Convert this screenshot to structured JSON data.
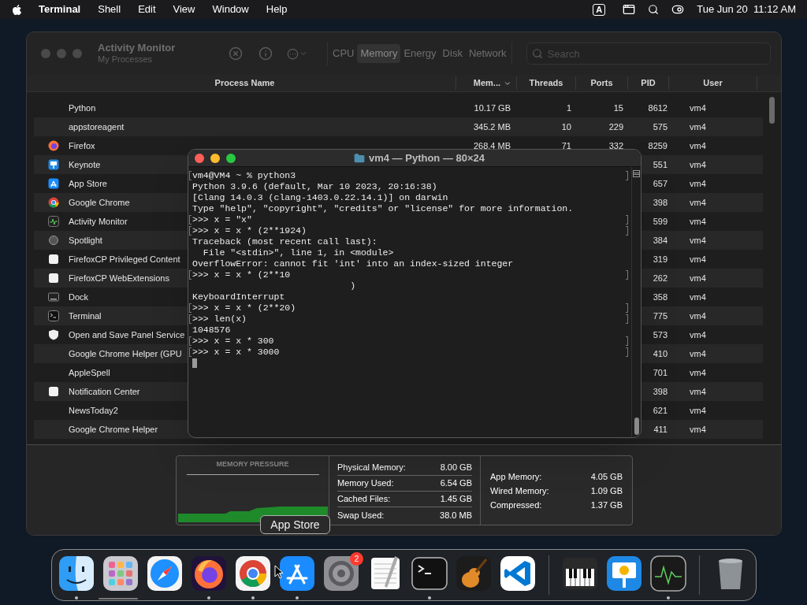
{
  "menu_bar": {
    "app": "Terminal",
    "menus": [
      "Shell",
      "Edit",
      "View",
      "Window",
      "Help"
    ],
    "input_source": "A",
    "clock": "Tue Jun 20  11:12 AM"
  },
  "activity_monitor": {
    "title": "Activity Monitor",
    "subtitle": "My Processes",
    "tabs": [
      {
        "label": "CPU",
        "selected": false
      },
      {
        "label": "Memory",
        "selected": true
      },
      {
        "label": "Energy",
        "selected": false
      },
      {
        "label": "Disk",
        "selected": false
      },
      {
        "label": "Network",
        "selected": false
      }
    ],
    "search": {
      "placeholder": "Search"
    },
    "columns": [
      "Process Name",
      "Mem...",
      "Threads",
      "Ports",
      "PID",
      "User"
    ],
    "rows": [
      {
        "kind": "plain",
        "name": "Python",
        "memory": "10.17 GB",
        "threads": "1",
        "ports": "15",
        "pid": "8612",
        "user": "vm4"
      },
      {
        "kind": "plain",
        "name": "appstoreagent",
        "memory": "345.2 MB",
        "threads": "10",
        "ports": "229",
        "pid": "575",
        "user": "vm4"
      },
      {
        "kind": "firefox",
        "name": "Firefox",
        "memory": "268.4 MB",
        "threads": "71",
        "ports": "332",
        "pid": "8259",
        "user": "vm4"
      },
      {
        "kind": "keynote",
        "name": "Keynote",
        "pid": "551",
        "user": "vm4"
      },
      {
        "kind": "appstore",
        "name": "App Store",
        "pid": "657",
        "user": "vm4"
      },
      {
        "kind": "chrome",
        "name": "Google Chrome",
        "pid": "398",
        "user": "vm4"
      },
      {
        "kind": "activity",
        "name": "Activity Monitor",
        "pid": "599",
        "user": "vm4"
      },
      {
        "kind": "spotlight",
        "name": "Spotlight",
        "pid": "384",
        "user": "vm4"
      },
      {
        "kind": "document",
        "name": "FirefoxCP Privileged Content",
        "pid": "319",
        "user": "vm4"
      },
      {
        "kind": "document",
        "name": "FirefoxCP WebExtensions",
        "pid": "262",
        "user": "vm4"
      },
      {
        "kind": "dock",
        "name": "Dock",
        "pid": "358",
        "user": "vm4"
      },
      {
        "kind": "terminal",
        "name": "Terminal",
        "pid": "775",
        "user": "vm4"
      },
      {
        "kind": "shield",
        "name": "Open and Save Panel Service",
        "pid": "573",
        "user": "vm4"
      },
      {
        "kind": "plain",
        "name": "Google Chrome Helper (GPU",
        "pid": "410",
        "user": "vm4"
      },
      {
        "kind": "plain",
        "name": "AppleSpell",
        "pid": "701",
        "user": "vm4"
      },
      {
        "kind": "document",
        "name": "Notification Center",
        "pid": "398",
        "user": "vm4"
      },
      {
        "kind": "plain",
        "name": "NewsToday2",
        "pid": "621",
        "user": "vm4"
      },
      {
        "kind": "plain",
        "name": "Google Chrome Helper",
        "pid": "411",
        "user": "vm4"
      }
    ],
    "memory_panel": {
      "title": "MEMORY PRESSURE",
      "stats": [
        {
          "label": "Physical Memory:",
          "value": "8.00 GB"
        },
        {
          "label": "Memory Used:",
          "value": "6.54 GB"
        },
        {
          "label": "Cached Files:",
          "value": "1.45 GB"
        },
        {
          "label": "Swap Used:",
          "value": "38.0 MB"
        }
      ],
      "breakdown": [
        {
          "label": "App Memory:",
          "value": "4.05 GB"
        },
        {
          "label": "Wired Memory:",
          "value": "1.09 GB"
        },
        {
          "label": "Compressed:",
          "value": "1.37 GB"
        }
      ]
    }
  },
  "terminal": {
    "title": "vm4 — Python — 80×24",
    "lines": [
      {
        "kind": "prompt",
        "text": "vm4@VM4 ~ % python3"
      },
      {
        "kind": "output",
        "text": "Python 3.9.6 (default, Mar 10 2023, 20:16:38)"
      },
      {
        "kind": "output",
        "text": "[Clang 14.0.3 (clang-1403.0.22.14.1)] on darwin"
      },
      {
        "kind": "output",
        "text": "Type \"help\", \"copyright\", \"credits\" or \"license\" for more information."
      },
      {
        "kind": "prompt",
        "text": ">>> x = \"x\""
      },
      {
        "kind": "prompt",
        "text": ">>> x = x * (2**1924)"
      },
      {
        "kind": "output",
        "text": "Traceback (most recent call last):"
      },
      {
        "kind": "output",
        "text": "  File \"<stdin>\", line 1, in <module>"
      },
      {
        "kind": "output",
        "text": "OverflowError: cannot fit 'int' into an index-sized integer"
      },
      {
        "kind": "prompt",
        "text": ">>> x = x * (2**10"
      },
      {
        "kind": "output",
        "text": "                             )"
      },
      {
        "kind": "output",
        "text": "KeyboardInterrupt"
      },
      {
        "kind": "prompt",
        "text": ">>> x = x * (2**20)"
      },
      {
        "kind": "prompt",
        "text": ">>> len(x)"
      },
      {
        "kind": "output",
        "text": "1048576"
      },
      {
        "kind": "prompt",
        "text": ">>> x = x * 300"
      },
      {
        "kind": "prompt",
        "text": ">>> x = x * 3000"
      }
    ]
  },
  "tooltip": "App Store",
  "dock": {
    "sections": [
      {
        "items": [
          {
            "kind": "finder",
            "running": true
          },
          {
            "kind": "launchpad",
            "running": false
          },
          {
            "kind": "safari",
            "running": false
          },
          {
            "kind": "firefox",
            "running": true
          },
          {
            "kind": "chrome",
            "running": true
          },
          {
            "kind": "appstore",
            "running": true
          },
          {
            "kind": "settings",
            "running": false,
            "badge": "2"
          },
          {
            "kind": "textedit",
            "running": false
          },
          {
            "kind": "terminal",
            "running": true
          },
          {
            "kind": "garageband",
            "running": false
          },
          {
            "kind": "vscode",
            "running": false
          }
        ]
      },
      {
        "items": [
          {
            "kind": "piano",
            "running": false
          },
          {
            "kind": "keynote",
            "running": false
          },
          {
            "kind": "activity",
            "running": true
          }
        ]
      },
      {
        "items": [
          {
            "kind": "trash",
            "running": false
          }
        ]
      }
    ]
  }
}
